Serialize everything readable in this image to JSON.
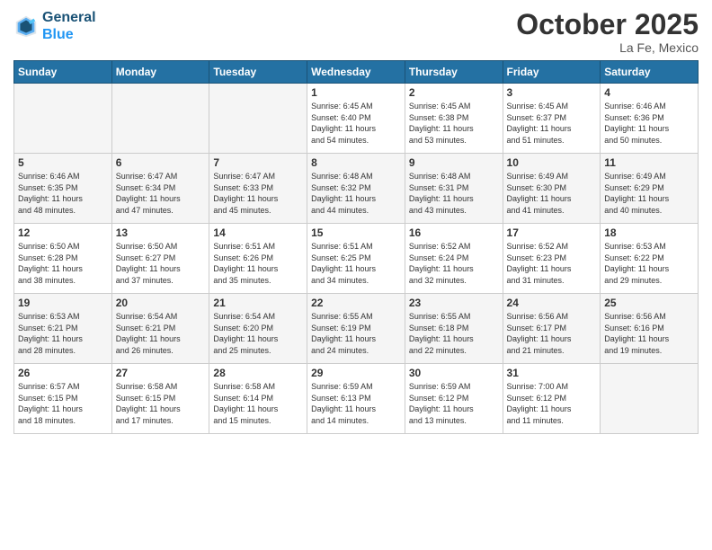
{
  "header": {
    "logo_line1": "General",
    "logo_line2": "Blue",
    "month": "October 2025",
    "location": "La Fe, Mexico"
  },
  "weekdays": [
    "Sunday",
    "Monday",
    "Tuesday",
    "Wednesday",
    "Thursday",
    "Friday",
    "Saturday"
  ],
  "rows": [
    [
      {
        "day": "",
        "info": ""
      },
      {
        "day": "",
        "info": ""
      },
      {
        "day": "",
        "info": ""
      },
      {
        "day": "1",
        "info": "Sunrise: 6:45 AM\nSunset: 6:40 PM\nDaylight: 11 hours\nand 54 minutes."
      },
      {
        "day": "2",
        "info": "Sunrise: 6:45 AM\nSunset: 6:38 PM\nDaylight: 11 hours\nand 53 minutes."
      },
      {
        "day": "3",
        "info": "Sunrise: 6:45 AM\nSunset: 6:37 PM\nDaylight: 11 hours\nand 51 minutes."
      },
      {
        "day": "4",
        "info": "Sunrise: 6:46 AM\nSunset: 6:36 PM\nDaylight: 11 hours\nand 50 minutes."
      }
    ],
    [
      {
        "day": "5",
        "info": "Sunrise: 6:46 AM\nSunset: 6:35 PM\nDaylight: 11 hours\nand 48 minutes."
      },
      {
        "day": "6",
        "info": "Sunrise: 6:47 AM\nSunset: 6:34 PM\nDaylight: 11 hours\nand 47 minutes."
      },
      {
        "day": "7",
        "info": "Sunrise: 6:47 AM\nSunset: 6:33 PM\nDaylight: 11 hours\nand 45 minutes."
      },
      {
        "day": "8",
        "info": "Sunrise: 6:48 AM\nSunset: 6:32 PM\nDaylight: 11 hours\nand 44 minutes."
      },
      {
        "day": "9",
        "info": "Sunrise: 6:48 AM\nSunset: 6:31 PM\nDaylight: 11 hours\nand 43 minutes."
      },
      {
        "day": "10",
        "info": "Sunrise: 6:49 AM\nSunset: 6:30 PM\nDaylight: 11 hours\nand 41 minutes."
      },
      {
        "day": "11",
        "info": "Sunrise: 6:49 AM\nSunset: 6:29 PM\nDaylight: 11 hours\nand 40 minutes."
      }
    ],
    [
      {
        "day": "12",
        "info": "Sunrise: 6:50 AM\nSunset: 6:28 PM\nDaylight: 11 hours\nand 38 minutes."
      },
      {
        "day": "13",
        "info": "Sunrise: 6:50 AM\nSunset: 6:27 PM\nDaylight: 11 hours\nand 37 minutes."
      },
      {
        "day": "14",
        "info": "Sunrise: 6:51 AM\nSunset: 6:26 PM\nDaylight: 11 hours\nand 35 minutes."
      },
      {
        "day": "15",
        "info": "Sunrise: 6:51 AM\nSunset: 6:25 PM\nDaylight: 11 hours\nand 34 minutes."
      },
      {
        "day": "16",
        "info": "Sunrise: 6:52 AM\nSunset: 6:24 PM\nDaylight: 11 hours\nand 32 minutes."
      },
      {
        "day": "17",
        "info": "Sunrise: 6:52 AM\nSunset: 6:23 PM\nDaylight: 11 hours\nand 31 minutes."
      },
      {
        "day": "18",
        "info": "Sunrise: 6:53 AM\nSunset: 6:22 PM\nDaylight: 11 hours\nand 29 minutes."
      }
    ],
    [
      {
        "day": "19",
        "info": "Sunrise: 6:53 AM\nSunset: 6:21 PM\nDaylight: 11 hours\nand 28 minutes."
      },
      {
        "day": "20",
        "info": "Sunrise: 6:54 AM\nSunset: 6:21 PM\nDaylight: 11 hours\nand 26 minutes."
      },
      {
        "day": "21",
        "info": "Sunrise: 6:54 AM\nSunset: 6:20 PM\nDaylight: 11 hours\nand 25 minutes."
      },
      {
        "day": "22",
        "info": "Sunrise: 6:55 AM\nSunset: 6:19 PM\nDaylight: 11 hours\nand 24 minutes."
      },
      {
        "day": "23",
        "info": "Sunrise: 6:55 AM\nSunset: 6:18 PM\nDaylight: 11 hours\nand 22 minutes."
      },
      {
        "day": "24",
        "info": "Sunrise: 6:56 AM\nSunset: 6:17 PM\nDaylight: 11 hours\nand 21 minutes."
      },
      {
        "day": "25",
        "info": "Sunrise: 6:56 AM\nSunset: 6:16 PM\nDaylight: 11 hours\nand 19 minutes."
      }
    ],
    [
      {
        "day": "26",
        "info": "Sunrise: 6:57 AM\nSunset: 6:15 PM\nDaylight: 11 hours\nand 18 minutes."
      },
      {
        "day": "27",
        "info": "Sunrise: 6:58 AM\nSunset: 6:15 PM\nDaylight: 11 hours\nand 17 minutes."
      },
      {
        "day": "28",
        "info": "Sunrise: 6:58 AM\nSunset: 6:14 PM\nDaylight: 11 hours\nand 15 minutes."
      },
      {
        "day": "29",
        "info": "Sunrise: 6:59 AM\nSunset: 6:13 PM\nDaylight: 11 hours\nand 14 minutes."
      },
      {
        "day": "30",
        "info": "Sunrise: 6:59 AM\nSunset: 6:12 PM\nDaylight: 11 hours\nand 13 minutes."
      },
      {
        "day": "31",
        "info": "Sunrise: 7:00 AM\nSunset: 6:12 PM\nDaylight: 11 hours\nand 11 minutes."
      },
      {
        "day": "",
        "info": ""
      }
    ]
  ]
}
